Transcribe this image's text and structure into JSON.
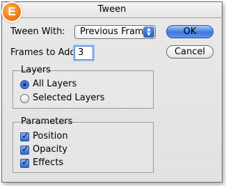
{
  "window": {
    "title": "Tween"
  },
  "badge": {
    "letter": "E"
  },
  "tween_with": {
    "label": "Tween With:",
    "value": "Previous Frame"
  },
  "frames": {
    "label": "Frames to Add:",
    "value": "3"
  },
  "buttons": {
    "ok": "OK",
    "cancel": "Cancel"
  },
  "layers": {
    "title": "Layers",
    "options": [
      {
        "label": "All Layers",
        "selected": true
      },
      {
        "label": "Selected Layers",
        "selected": false
      }
    ]
  },
  "parameters": {
    "title": "Parameters",
    "options": [
      {
        "label": "Position",
        "checked": true
      },
      {
        "label": "Opacity",
        "checked": true
      },
      {
        "label": "Effects",
        "checked": true
      }
    ]
  },
  "colors": {
    "accent": "#3d7ae0",
    "badge": "#f07d14"
  }
}
